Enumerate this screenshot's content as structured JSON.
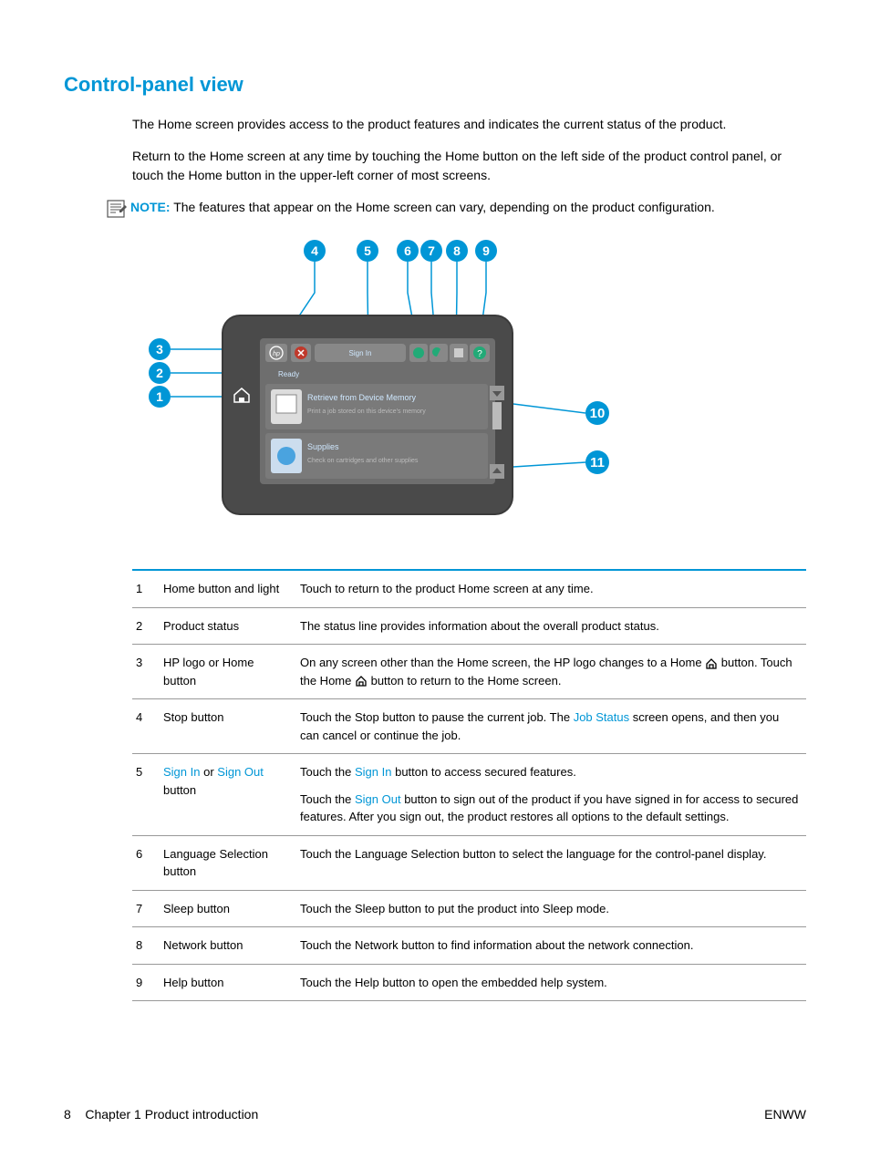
{
  "heading": "Control-panel view",
  "para1": "The Home screen provides access to the product features and indicates the current status of the product.",
  "para2": "Return to the Home screen at any time by touching the Home button on the left side of the product control panel, or touch the Home button in the upper-left corner of most screens.",
  "note": {
    "label": "NOTE:",
    "text": "The features that appear on the Home screen can vary, depending on the product configuration."
  },
  "callouts": [
    "1",
    "2",
    "3",
    "4",
    "5",
    "6",
    "7",
    "8",
    "9",
    "10",
    "11"
  ],
  "panel": {
    "status": "Ready",
    "signin": "Sign In",
    "item1_title": "Retrieve from Device Memory",
    "item1_sub": "Print a job stored on this device's memory",
    "item2_title": "Supplies",
    "item2_sub": "Check on cartridges and other supplies"
  },
  "rows": [
    {
      "num": "1",
      "label": "Home button and light",
      "desc": "Touch to return to the product Home screen at any time."
    },
    {
      "num": "2",
      "label": "Product status",
      "desc": "The status line provides information about the overall product status."
    },
    {
      "num": "3",
      "label": "HP logo or Home button",
      "desc_pre": "On any screen other than the Home screen, the HP logo changes to a Home ",
      "desc_mid": " button. Touch the Home ",
      "desc_post": " button to return to the Home screen."
    },
    {
      "num": "4",
      "label": "Stop button",
      "desc_pre": "Touch the Stop button to pause the current job. The ",
      "link": "Job Status",
      "desc_post": " screen opens, and then you can cancel or continue the job."
    },
    {
      "num": "5",
      "label_pre": "",
      "link1": "Sign In",
      "label_mid": " or ",
      "link2": "Sign Out",
      "label_post": " button",
      "p1_pre": "Touch the ",
      "p1_link": "Sign In",
      "p1_post": " button to access secured features.",
      "p2_pre": "Touch the ",
      "p2_link": "Sign Out",
      "p2_post": " button to sign out of the product if you have signed in for access to secured features. After you sign out, the product restores all options to the default settings."
    },
    {
      "num": "6",
      "label": "Language Selection button",
      "desc": "Touch the Language Selection button to select the language for the control-panel display."
    },
    {
      "num": "7",
      "label": "Sleep button",
      "desc": "Touch the Sleep button to put the product into Sleep mode."
    },
    {
      "num": "8",
      "label": "Network button",
      "desc": "Touch the Network button to find information about the network connection."
    },
    {
      "num": "9",
      "label": "Help button",
      "desc": "Touch the Help button to open the embedded help system."
    }
  ],
  "footer": {
    "left_page": "8",
    "left_text": "Chapter 1   Product introduction",
    "right": "ENWW"
  }
}
